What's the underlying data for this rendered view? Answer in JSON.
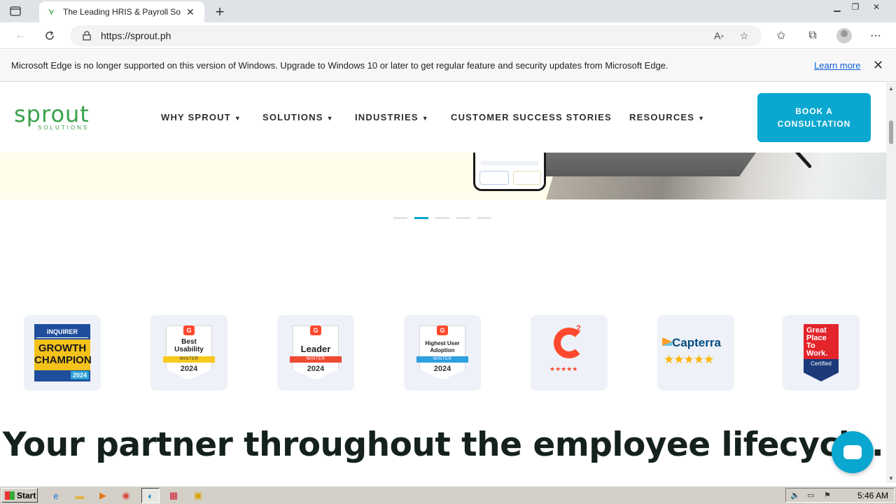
{
  "browser": {
    "tab_title": "The Leading HRIS & Payroll Sof",
    "url": "https://sprout.ph",
    "new_tab": "+",
    "tab_close": "✕"
  },
  "infobar": {
    "message": "Microsoft Edge is no longer supported on this version of Windows. Upgrade to Windows 10 or later to get regular feature and security updates from Microsoft Edge.",
    "learn_more": "Learn more",
    "close": "✕"
  },
  "site": {
    "logo_word": "sprout",
    "logo_sub": "SOLUTIONS",
    "nav": [
      {
        "label": "WHY SPROUT",
        "dropdown": true
      },
      {
        "label": "SOLUTIONS",
        "dropdown": true
      },
      {
        "label": "INDUSTRIES",
        "dropdown": true
      },
      {
        "label": "CUSTOMER SUCCESS STORIES",
        "dropdown": false
      },
      {
        "label": "RESOURCES",
        "dropdown": true
      }
    ],
    "caret": "▼",
    "cta_line1": "BOOK A",
    "cta_line2": "CONSULTATION",
    "accent_color": "#0aa7d0",
    "brand_green": "#3aa14a"
  },
  "carousel": {
    "slides": 5,
    "active_index": 1
  },
  "badges": {
    "inquirer": {
      "top": "INQUIRER",
      "line1": "GROWTH",
      "line2": "CHAMPION",
      "year": "2024"
    },
    "best_usability": {
      "line1": "Best",
      "line2": "Usability",
      "season": "WINTER",
      "year": "2024"
    },
    "leader": {
      "line1": "Leader",
      "season": "WINTER",
      "year": "2024"
    },
    "highest_adoption": {
      "line1": "Highest User",
      "line2": "Adoption",
      "season": "WINTER",
      "year": "2024"
    },
    "g2": {
      "two": "2",
      "stars": "★★★★★"
    },
    "capterra": {
      "name": "Capterra",
      "stars": "★★★★★"
    },
    "gptw": {
      "line1": "Great",
      "line2": "Place",
      "line3": "To",
      "line4": "Work.",
      "certified": "Certified"
    }
  },
  "headline": "Your partner throughout the employee lifecycle.",
  "taskbar": {
    "start": "Start",
    "clock": "5:46 AM"
  }
}
